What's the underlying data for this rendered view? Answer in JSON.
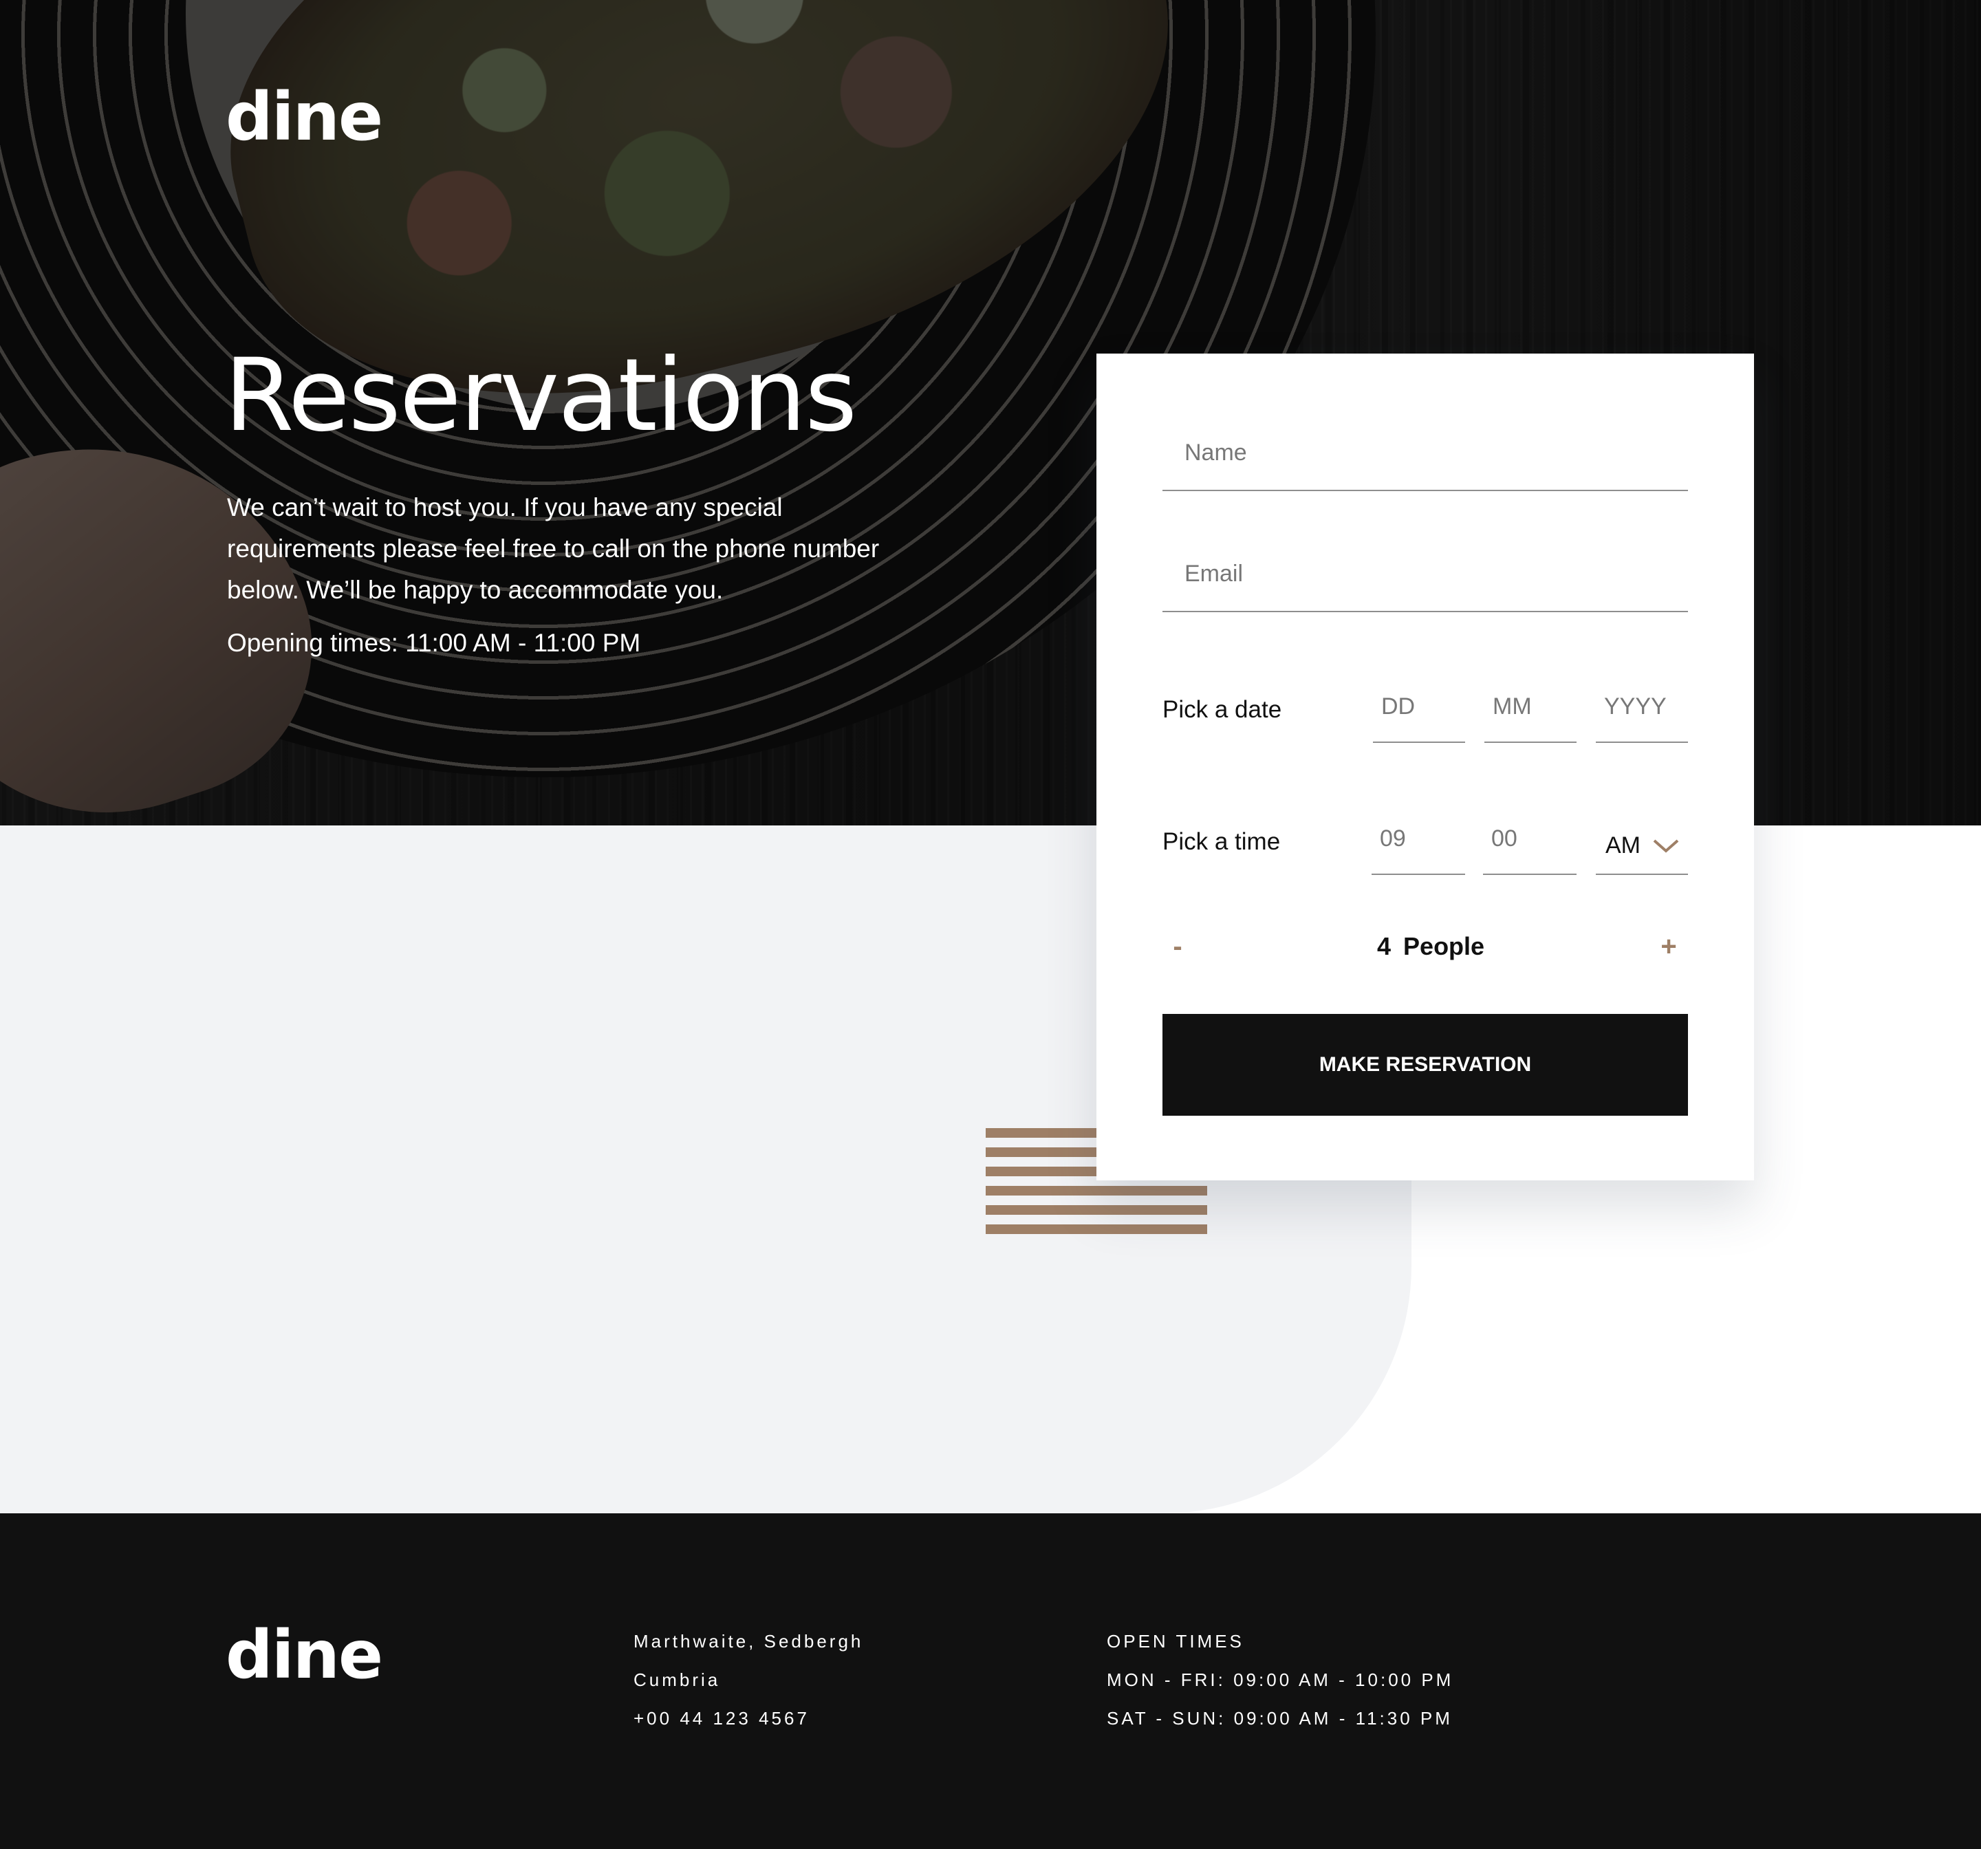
{
  "brand": {
    "logo": "dine"
  },
  "hero": {
    "title": "Reservations",
    "description": "We can’t wait to host you. If you have any special requirements please feel free to call on the phone number below. We’ll be happy to accommodate you.",
    "hours": "Opening times: 11:00 AM - 11:00 PM"
  },
  "form": {
    "name_placeholder": "Name",
    "email_placeholder": "Email",
    "date_label": "Pick a date",
    "date_day_placeholder": "DD",
    "date_month_placeholder": "MM",
    "date_year_placeholder": "YYYY",
    "time_label": "Pick a time",
    "time_hour_placeholder": "09",
    "time_minute_placeholder": "00",
    "time_period": "AM",
    "people_minus": "-",
    "people_count": "4",
    "people_unit": "People",
    "people_plus": "+",
    "submit_label": "MAKE RESERVATION"
  },
  "footer": {
    "address_line1": "Marthwaite, Sedbergh",
    "address_line2": "Cumbria",
    "phone": "+00 44 123 4567",
    "open_times_title": "OPEN TIMES",
    "weekday_hours": "MON - FRI: 09:00 AM - 10:00 PM",
    "weekend_hours": "SAT - SUN: 09:00 AM - 11:30 PM"
  },
  "colors": {
    "accent": "#9e7f66",
    "dark": "#111111",
    "light_bg": "#f2f3f5"
  },
  "icons": {
    "ampm_dropdown": "chevron-down-icon",
    "decoration": "stripes-pattern"
  }
}
